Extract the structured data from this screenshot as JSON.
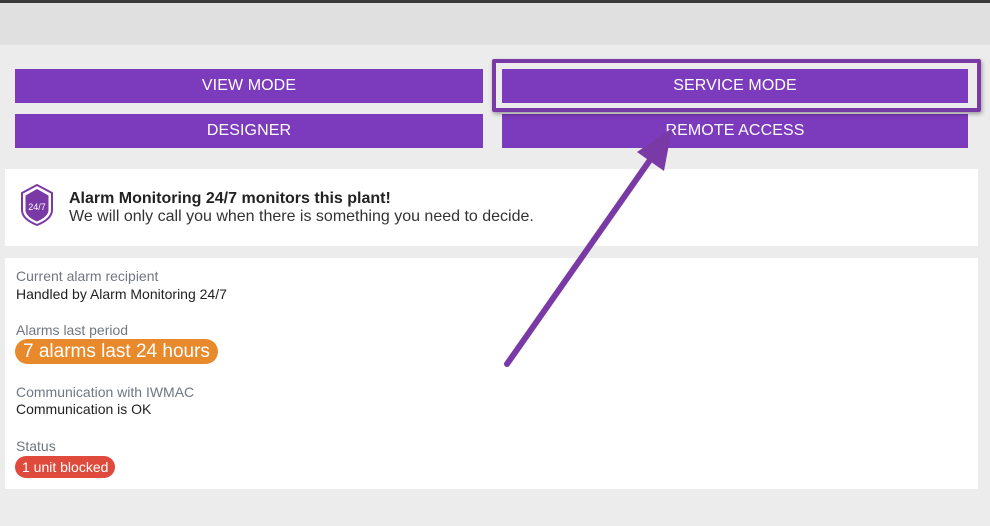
{
  "buttons": {
    "view_mode": "VIEW MODE",
    "service_mode": "SERVICE MODE",
    "designer": "DESIGNER",
    "remote_access": "REMOTE ACCESS"
  },
  "banner": {
    "shield_text": "24/7",
    "title": "Alarm Monitoring 24/7 monitors this plant!",
    "subtitle": "We will only call you when there is something you need to decide."
  },
  "status": {
    "recipient_label": "Current alarm recipient",
    "recipient_value": "Handled by Alarm Monitoring 24/7",
    "alarms_label": "Alarms last period",
    "alarms_value": "7 alarms last 24 hours",
    "comm_label": "Communication with IWMAC",
    "comm_value": "Communication is OK",
    "status_label": "Status",
    "status_value": "1 unit blocked"
  },
  "colors": {
    "button_purple": "#7c3bbc",
    "highlight_purple": "#7a3aa6",
    "alarm_orange": "#e8892b",
    "blocked_red": "#e04a3c"
  }
}
